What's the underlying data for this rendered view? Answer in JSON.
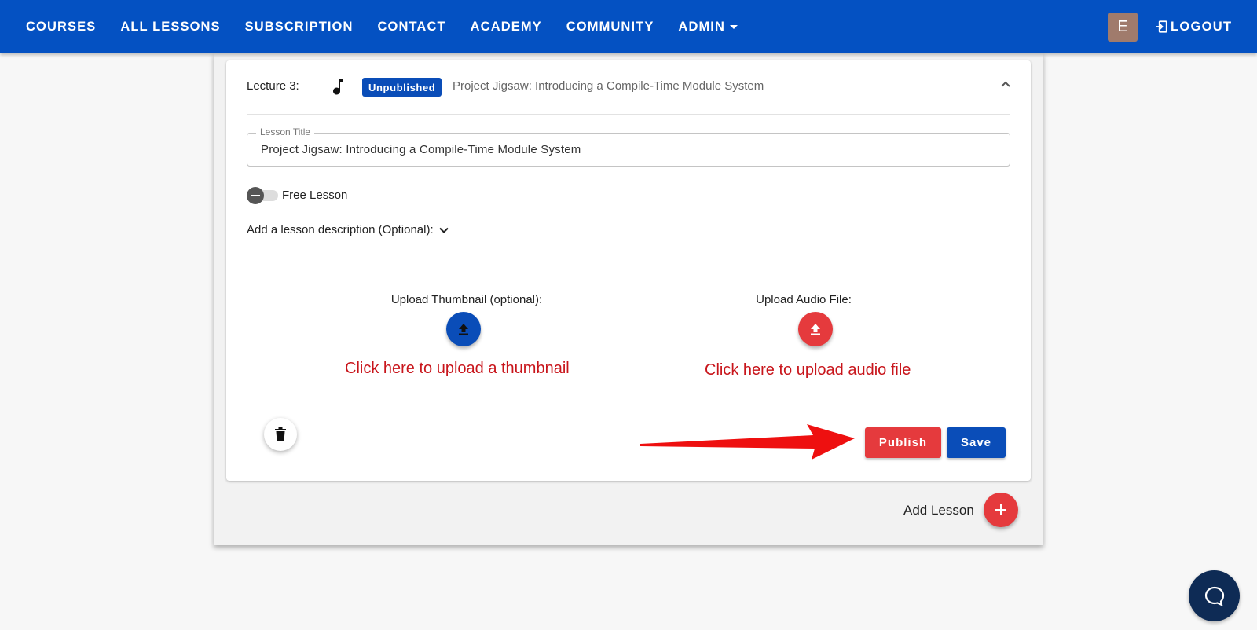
{
  "nav": {
    "items": [
      {
        "label": "COURSES"
      },
      {
        "label": "ALL LESSONS"
      },
      {
        "label": "SUBSCRIPTION"
      },
      {
        "label": "CONTACT"
      },
      {
        "label": "ACADEMY"
      },
      {
        "label": "COMMUNITY"
      },
      {
        "label": "ADMIN",
        "icon": "caret-down-icon"
      }
    ],
    "avatar_initial": "E",
    "logout_label": "LOGOUT",
    "colors": {
      "bar": "#0451c2",
      "avatar": "#a07b6c"
    }
  },
  "lecture": {
    "label": "Lecture 3:",
    "type_icon": "music-note-icon",
    "status_badge": "Unpublished",
    "title": "Project Jigsaw: Introducing a Compile-Time Module System",
    "expanded": true
  },
  "form": {
    "lesson_title_label": "Lesson Title",
    "lesson_title_value": "Project Jigsaw: Introducing a Compile-Time Module System",
    "free_lesson_label": "Free Lesson",
    "free_lesson_on": false,
    "description_toggle": "Add a lesson description (Optional):"
  },
  "uploads": {
    "thumbnail_label": "Upload Thumbnail (optional):",
    "thumbnail_annotation": "Click here to upload a thumbnail",
    "audio_label": "Upload Audio File:",
    "audio_annotation": "Click here to upload audio file"
  },
  "actions": {
    "publish_label": "Publish",
    "save_label": "Save",
    "add_lesson_label": "Add Lesson"
  },
  "colors": {
    "primary": "#0a4db8",
    "danger": "#e53a3d",
    "annotation": "#c8151b",
    "chat": "#0e2b55"
  }
}
